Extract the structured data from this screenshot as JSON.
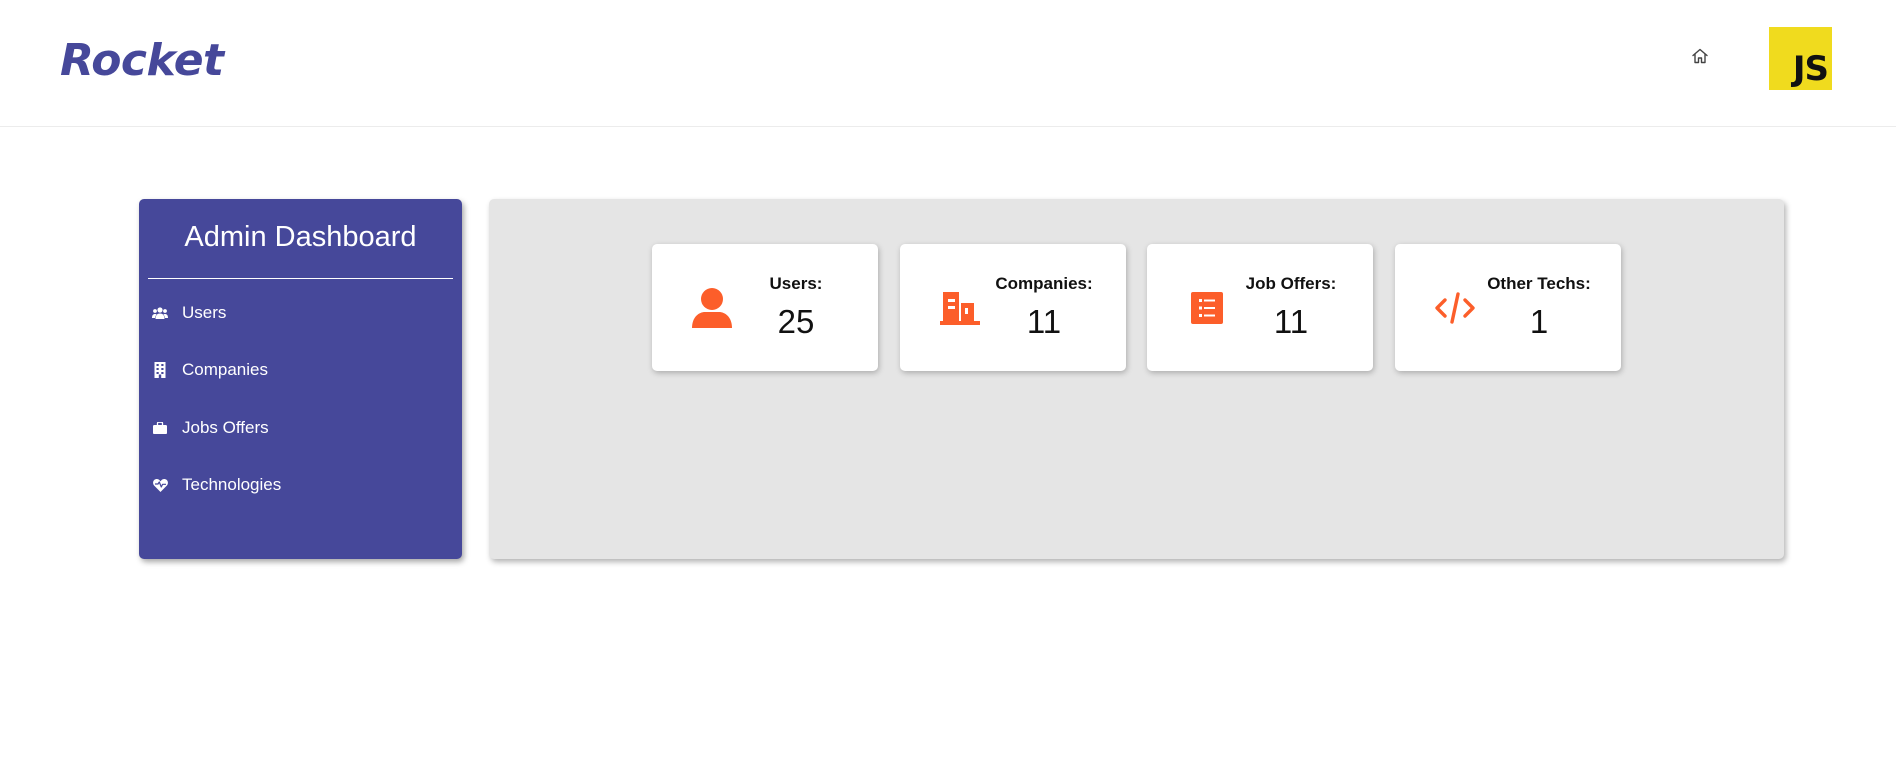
{
  "header": {
    "brand": "Rocket",
    "home_icon": "home-icon",
    "avatar_text": "JS",
    "avatar_color": "#f0db1e",
    "brand_color": "#46489a"
  },
  "sidebar": {
    "title": "Admin Dashboard",
    "background": "#46489a",
    "items": [
      {
        "label": "Users",
        "icon": "users-icon"
      },
      {
        "label": "Companies",
        "icon": "building-icon"
      },
      {
        "label": "Jobs Offers",
        "icon": "briefcase-icon"
      },
      {
        "label": "Technologies",
        "icon": "heart-icon"
      }
    ]
  },
  "stats": {
    "accent_color": "#fc5e2a",
    "cards": [
      {
        "label": "Users:",
        "value": "25",
        "icon": "user-icon"
      },
      {
        "label": "Companies:",
        "value": "11",
        "icon": "building-icon"
      },
      {
        "label": "Job Offers:",
        "value": "11",
        "icon": "list-icon"
      },
      {
        "label": "Other Techs:",
        "value": "1",
        "icon": "code-icon"
      }
    ]
  }
}
